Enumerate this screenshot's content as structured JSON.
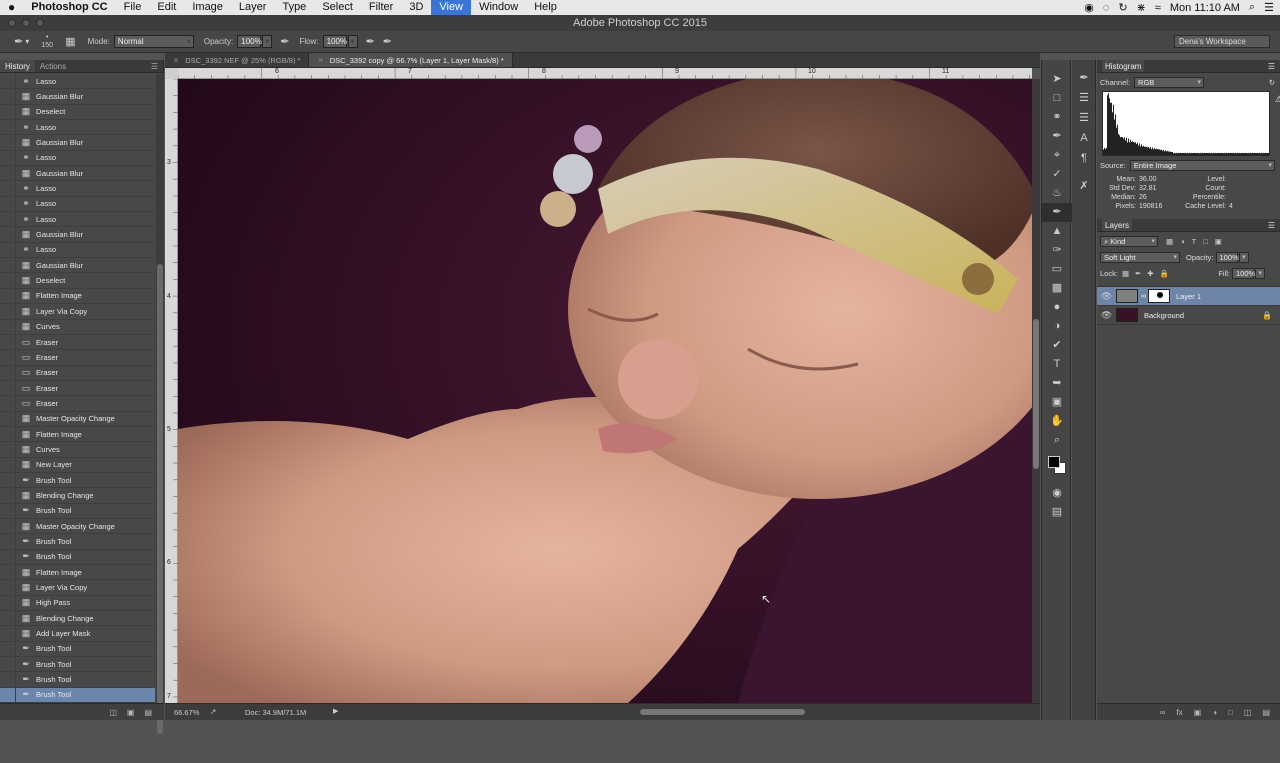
{
  "menubar": {
    "apple": "",
    "app": "Photoshop CC",
    "items": [
      "File",
      "Edit",
      "Image",
      "Layer",
      "Type",
      "Select",
      "Filter",
      "3D",
      "View",
      "Window",
      "Help"
    ],
    "active": "View",
    "clock": "Mon 11:10 AM"
  },
  "window_title": "Adobe Photoshop CC 2015",
  "options": {
    "brush_size": "150",
    "mode_label": "Mode:",
    "mode_value": "Normal",
    "opacity_label": "Opacity:",
    "opacity_value": "100%",
    "flow_label": "Flow:",
    "flow_value": "100%",
    "workspace": "Dena's Workspace"
  },
  "history_panel": {
    "tabs": [
      "History",
      "Actions"
    ],
    "items": [
      {
        "label": "Lasso",
        "icon": "lasso-icon"
      },
      {
        "label": "Gaussian Blur",
        "icon": "doc-icon"
      },
      {
        "label": "Deselect",
        "icon": "doc-icon"
      },
      {
        "label": "Lasso",
        "icon": "lasso-icon"
      },
      {
        "label": "Gaussian Blur",
        "icon": "doc-icon"
      },
      {
        "label": "Lasso",
        "icon": "lasso-icon"
      },
      {
        "label": "Gaussian Blur",
        "icon": "doc-icon"
      },
      {
        "label": "Lasso",
        "icon": "lasso-icon"
      },
      {
        "label": "Lasso",
        "icon": "lasso-icon"
      },
      {
        "label": "Lasso",
        "icon": "lasso-icon"
      },
      {
        "label": "Gaussian Blur",
        "icon": "doc-icon"
      },
      {
        "label": "Lasso",
        "icon": "lasso-icon"
      },
      {
        "label": "Gaussian Blur",
        "icon": "doc-icon"
      },
      {
        "label": "Deselect",
        "icon": "doc-icon"
      },
      {
        "label": "Flatten Image",
        "icon": "doc-icon"
      },
      {
        "label": "Layer Via Copy",
        "icon": "doc-icon"
      },
      {
        "label": "Curves",
        "icon": "doc-icon"
      },
      {
        "label": "Eraser",
        "icon": "eraser-icon"
      },
      {
        "label": "Eraser",
        "icon": "eraser-icon"
      },
      {
        "label": "Eraser",
        "icon": "eraser-icon"
      },
      {
        "label": "Eraser",
        "icon": "eraser-icon"
      },
      {
        "label": "Eraser",
        "icon": "eraser-icon"
      },
      {
        "label": "Master Opacity Change",
        "icon": "doc-icon"
      },
      {
        "label": "Flatten Image",
        "icon": "doc-icon"
      },
      {
        "label": "Curves",
        "icon": "doc-icon"
      },
      {
        "label": "New Layer",
        "icon": "doc-icon"
      },
      {
        "label": "Brush Tool",
        "icon": "brush-icon"
      },
      {
        "label": "Blending Change",
        "icon": "doc-icon"
      },
      {
        "label": "Brush Tool",
        "icon": "brush-icon"
      },
      {
        "label": "Master Opacity Change",
        "icon": "doc-icon"
      },
      {
        "label": "Brush Tool",
        "icon": "brush-icon"
      },
      {
        "label": "Brush Tool",
        "icon": "brush-icon"
      },
      {
        "label": "Flatten Image",
        "icon": "doc-icon"
      },
      {
        "label": "Layer Via Copy",
        "icon": "doc-icon"
      },
      {
        "label": "High Pass",
        "icon": "doc-icon"
      },
      {
        "label": "Blending Change",
        "icon": "doc-icon"
      },
      {
        "label": "Add Layer Mask",
        "icon": "doc-icon"
      },
      {
        "label": "Brush Tool",
        "icon": "brush-icon"
      },
      {
        "label": "Brush Tool",
        "icon": "brush-icon"
      },
      {
        "label": "Brush Tool",
        "icon": "brush-icon"
      },
      {
        "label": "Brush Tool",
        "icon": "brush-icon",
        "selected": true
      }
    ]
  },
  "doc_tabs": [
    {
      "label": "DSC_3392.NEF @ 25% (RGB/8) *",
      "active": false
    },
    {
      "label": "DSC_3392 copy @ 66.7% (Layer 1, Layer Mask/8) *",
      "active": true
    }
  ],
  "rulers": {
    "top": [
      "6",
      "7",
      "8",
      "9",
      "10",
      "11"
    ],
    "left": [
      "3",
      "4",
      "5",
      "6",
      "7"
    ]
  },
  "status": {
    "zoom": "66.67%",
    "doc": "Doc: 34.9M/71.1M"
  },
  "histogram": {
    "title": "Histogram",
    "channel_label": "Channel:",
    "channel": "RGB",
    "source_label": "Source:",
    "source": "Entire Image",
    "stats": {
      "mean_label": "Mean:",
      "mean": "36.00",
      "stddev_label": "Std Dev:",
      "stddev": "32.81",
      "median_label": "Median:",
      "median": "26",
      "pixels_label": "Pixels:",
      "pixels": "190816",
      "level_label": "Level:",
      "count_label": "Count:",
      "percentile_label": "Percentile:",
      "cache_label": "Cache Level:",
      "cache": "4"
    }
  },
  "layers_panel": {
    "title": "Layers",
    "filter": "Kind",
    "blend": "Soft Light",
    "opacity_label": "Opacity:",
    "opacity": "100%",
    "lock_label": "Lock:",
    "fill_label": "Fill:",
    "fill": "100%",
    "layers": [
      {
        "name": "Layer 1",
        "selected": true
      },
      {
        "name": "Background",
        "selected": false
      }
    ]
  },
  "colors": {
    "accent": "#3875d7",
    "selection": "#6a86ad",
    "backdrop": "#2a0e1e"
  }
}
